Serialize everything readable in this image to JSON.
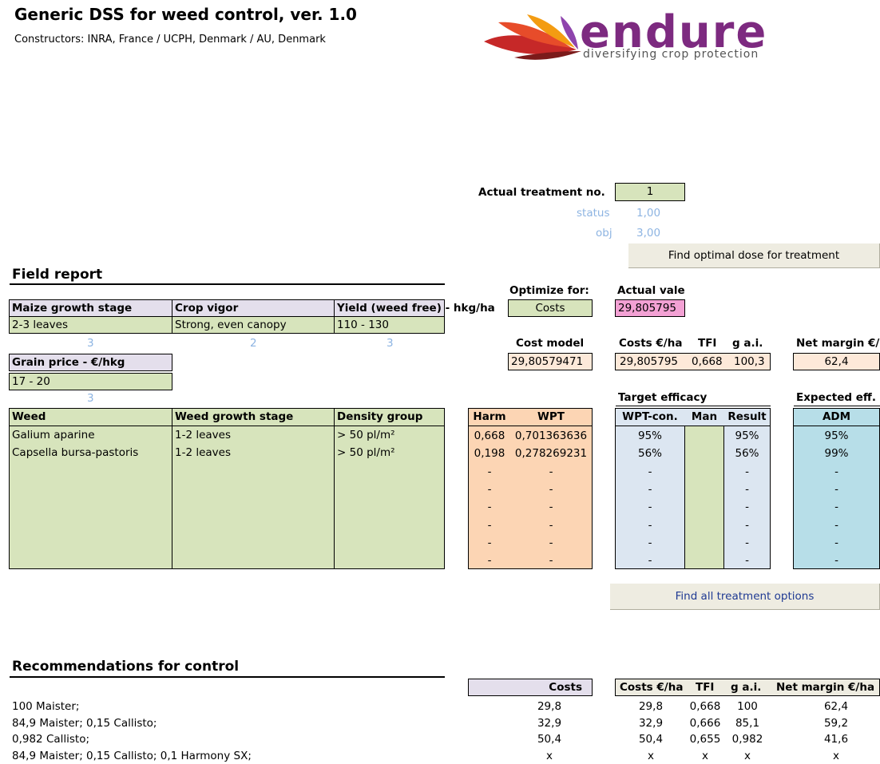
{
  "header": {
    "title": "Generic DSS for weed control, ver. 1.0",
    "constructors": "Constructors: INRA, France / UCPH, Denmark / AU, Denmark",
    "logo_text": "endure",
    "logo_tagline": "diversifying crop protection"
  },
  "treatment": {
    "label": "Actual treatment no.",
    "value": "1",
    "status_label": "status",
    "status_value": "1,00",
    "obj_label": "obj",
    "obj_value": "3,00",
    "find_optimal_label": "Find optimal dose for  treatment"
  },
  "field_report": {
    "title": "Field report",
    "headers": [
      "Maize growth stage",
      "Crop vigor",
      "Yield (weed free) - hkg/ha"
    ],
    "values": [
      "2-3 leaves",
      "Strong, even canopy",
      "110 - 130"
    ],
    "codes": [
      "3",
      "2",
      "3"
    ],
    "grain_price_label": "Grain price - €/hkg",
    "grain_price_value": "17 - 20",
    "grain_price_code": "3"
  },
  "optimize": {
    "label": "Optimize for:",
    "value": "Costs",
    "actual_label": "Actual vale",
    "actual_value": "29,805795"
  },
  "cost_model": {
    "label": "Cost model",
    "value": "29,80579471",
    "headers": [
      "Costs €/ha",
      "TFI",
      "g a.i.",
      "Net margin €/ha"
    ],
    "values": [
      "29,805795",
      "0,668",
      "100,3",
      "62,4"
    ]
  },
  "weeds": {
    "headers": [
      "Weed",
      "Weed growth stage",
      "Density group"
    ],
    "rows": [
      {
        "weed": "Galium aparine",
        "stage": "1-2 leaves",
        "density": "> 50 pl/m²"
      },
      {
        "weed": "Capsella bursa-pastoris",
        "stage": "1-2 leaves",
        "density": "> 50 pl/m²"
      }
    ]
  },
  "harm_wpt": {
    "headers": [
      "Harm",
      "WPT"
    ],
    "rows": [
      [
        "0,668",
        "0,701363636"
      ],
      [
        "0,198",
        "0,278269231"
      ],
      [
        "-",
        "-"
      ],
      [
        "-",
        "-"
      ],
      [
        "-",
        "-"
      ],
      [
        "-",
        "-"
      ],
      [
        "-",
        "-"
      ],
      [
        "-",
        "-"
      ]
    ]
  },
  "target_efficacy": {
    "title": "Target efficacy",
    "headers": [
      "WPT-con.",
      "Man",
      "Result"
    ],
    "rows": [
      [
        "95%",
        "",
        "95%"
      ],
      [
        "56%",
        "",
        "56%"
      ],
      [
        "-",
        "",
        "-"
      ],
      [
        "-",
        "",
        "-"
      ],
      [
        "-",
        "",
        "-"
      ],
      [
        "-",
        "",
        "-"
      ],
      [
        "-",
        "",
        "-"
      ],
      [
        "-",
        "",
        "-"
      ]
    ]
  },
  "expected_eff": {
    "title": "Expected eff.",
    "header": "ADM",
    "rows": [
      "95%",
      "99%",
      "-",
      "-",
      "-",
      "-",
      "-",
      "-"
    ]
  },
  "find_all_label": "Find all treatment options",
  "recommendations": {
    "title": "Recommendations for control",
    "costs_header": "Costs",
    "headers": [
      "Costs €/ha",
      "TFI",
      "g a.i.",
      "Net margin €/ha"
    ],
    "rows": [
      {
        "name": "100 Maister;",
        "costs": "29,8",
        "cha": "29,8",
        "tfi": "0,668",
        "gai": "100",
        "net": "62,4"
      },
      {
        "name": "84,9  Maister; 0,15  Callisto;",
        "costs": "32,9",
        "cha": "32,9",
        "tfi": "0,666",
        "gai": "85,1",
        "net": "59,2"
      },
      {
        "name": "0,982  Callisto;",
        "costs": "50,4",
        "cha": "50,4",
        "tfi": "0,655",
        "gai": "0,982",
        "net": "41,6"
      },
      {
        "name": "84,9  Maister; 0,15  Callisto; 0,1  Harmony SX;",
        "costs": "x",
        "cha": "x",
        "tfi": "x",
        "gai": "x",
        "net": "x"
      }
    ]
  }
}
